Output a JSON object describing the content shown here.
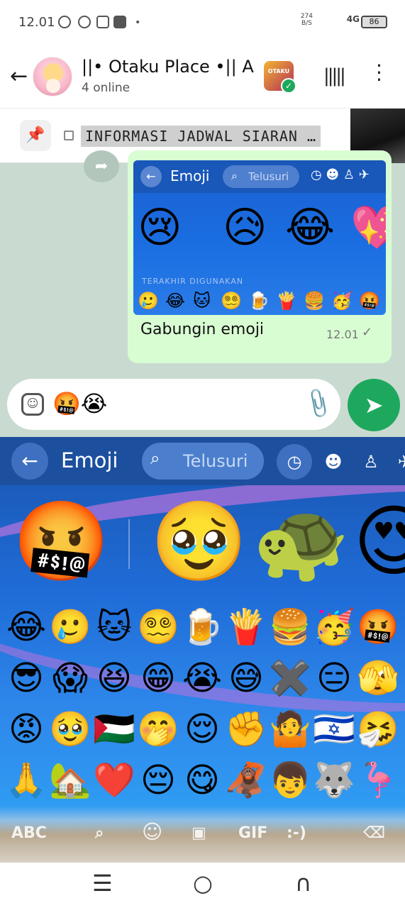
{
  "status": {
    "time": "12.01",
    "net_speed": "274",
    "net_unit": "B/S",
    "network": "4G",
    "battery": "86"
  },
  "header": {
    "title": "||• Otaku Place •|| A...",
    "subtitle": "4 online",
    "group_logo_text": "OTAKU"
  },
  "pinned": {
    "text": "INFORMASI JADWAL SIARAN …"
  },
  "message": {
    "caption": "Gabungin emoji",
    "time": "12.01",
    "preview": {
      "label": "Emoji",
      "search_placeholder": "Telusuri",
      "recent_label": "TERAKHIR DIGUNAKAN",
      "big_emojis": [
        "😢",
        "😥",
        "😂",
        "💖"
      ],
      "small_emojis": [
        "🥲",
        "😂",
        "🐱",
        "😵‍💫",
        "🍺",
        "🍟",
        "🍔",
        "🥳",
        "🤬"
      ]
    }
  },
  "composer": {
    "text": "🤬😭"
  },
  "keyboard": {
    "label": "Emoji",
    "search_placeholder": "Telusuri",
    "big_emojis": [
      "🤬",
      "🥹",
      "🐢",
      "😍"
    ],
    "grid": [
      [
        "😂",
        "🥲",
        "🐱",
        "😵‍💫",
        "🍺",
        "🍟",
        "🍔",
        "🥳",
        "🤬"
      ],
      [
        "😎",
        "😱",
        "😆",
        "😁",
        "😭",
        "😅",
        "✖️",
        "😑",
        "🫣"
      ],
      [
        "😡",
        "🥹",
        "🇵🇸",
        "🤭",
        "😌",
        "✊",
        "🤷",
        "🇮🇱",
        "🤧"
      ],
      [
        "🙏",
        "🏡",
        "❤️",
        "😔",
        "😋",
        "🦧",
        "👦",
        "🐺",
        "🦩"
      ]
    ],
    "footer": [
      "ABC",
      "",
      "",
      "",
      "GIF",
      ":-)",
      ""
    ]
  },
  "nav": {
    "recents": "☰",
    "home": "○",
    "back": "∩"
  }
}
